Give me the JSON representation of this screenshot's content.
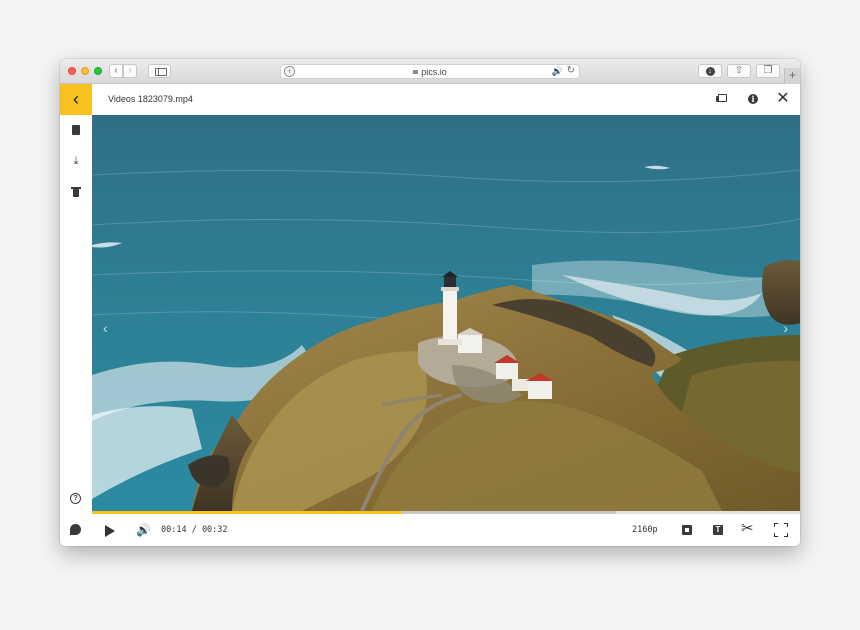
{
  "browser": {
    "url": "pics.io",
    "nav_back_glyph": "‹",
    "nav_forward_glyph": "›",
    "icons": [
      "back-icon",
      "forward-icon",
      "sidebar-toggle-icon",
      "add-icon",
      "lock-icon",
      "audio-playing-icon",
      "reload-icon",
      "downloads-icon",
      "share-icon",
      "tabs-icon",
      "new-tab-icon"
    ]
  },
  "viewer": {
    "file_name": "Videos 1823079.mp4",
    "back_glyph": "‹",
    "close_glyph": "✕",
    "info_glyph": "i",
    "accent_color": "#f8c120",
    "header_icons": [
      "copy-icon",
      "info-icon",
      "close-icon"
    ],
    "sidebar_icons": [
      "file-icon",
      "download-icon",
      "trash-icon",
      "help-icon",
      "chat-icon"
    ],
    "help_glyph": "?",
    "download_glyph": "⤓"
  },
  "player": {
    "current_time": "00:14",
    "duration": "00:32",
    "time_display": "00:14 / 00:32",
    "played_fraction": 0.4375,
    "buffered_fraction": 0.74,
    "quality": "2160p",
    "caption_glyph": "T",
    "scissors_glyph": "✂",
    "volume_glyph": "🔊",
    "control_icons": [
      "play-icon",
      "volume-icon",
      "snapshot-icon",
      "caption-icon",
      "scissors-icon",
      "fullscreen-icon"
    ]
  },
  "video_frame": {
    "scene": "aerial-lighthouse-coast",
    "prev_glyph": "‹",
    "next_glyph": "›"
  }
}
